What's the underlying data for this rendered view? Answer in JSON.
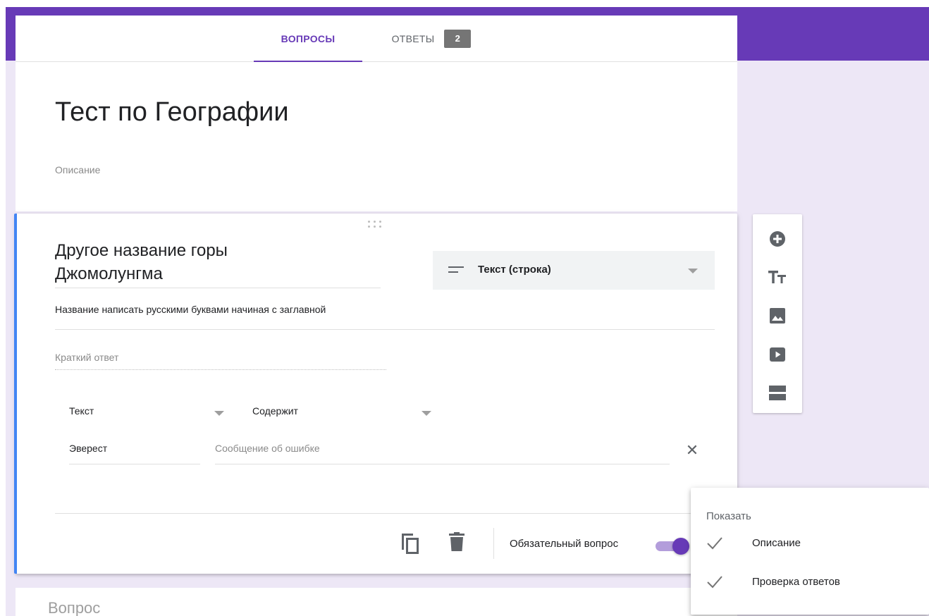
{
  "tabs": {
    "questions_label": "ВОПРОСЫ",
    "answers_label": "ОТВЕТЫ",
    "answers_count": "2"
  },
  "form": {
    "title": "Тест по Географии",
    "description_placeholder": "Описание"
  },
  "question": {
    "title_line1": "Другое название горы",
    "title_line2": "Джомолунгма",
    "type_label": "Текст (строка)",
    "type_icon": "short-text-icon",
    "description": "Название написать русскими буквами начиная с заглавной",
    "short_answer_placeholder": "Краткий ответ",
    "validation": {
      "type": "Текст",
      "condition": "Содержит",
      "text": "Эверест",
      "error_placeholder": "Сообщение об ошибке",
      "clear_symbol": "✕"
    },
    "required_label": "Обязательный вопрос",
    "required_on": true
  },
  "next_question": {
    "placeholder": "Вопрос"
  },
  "side_toolbar": {
    "icons": [
      "add-question-icon",
      "add-title-icon",
      "add-image-icon",
      "add-video-icon",
      "add-section-icon"
    ]
  },
  "show_menu": {
    "header": "Показать",
    "items": [
      {
        "label": "Описание",
        "checked": true
      },
      {
        "label": "Проверка ответов",
        "checked": true
      }
    ]
  },
  "colors": {
    "accent": "#673ab7",
    "accent_light": "#b39ddb",
    "background": "#ede7f6",
    "active_border": "#4285f4"
  }
}
